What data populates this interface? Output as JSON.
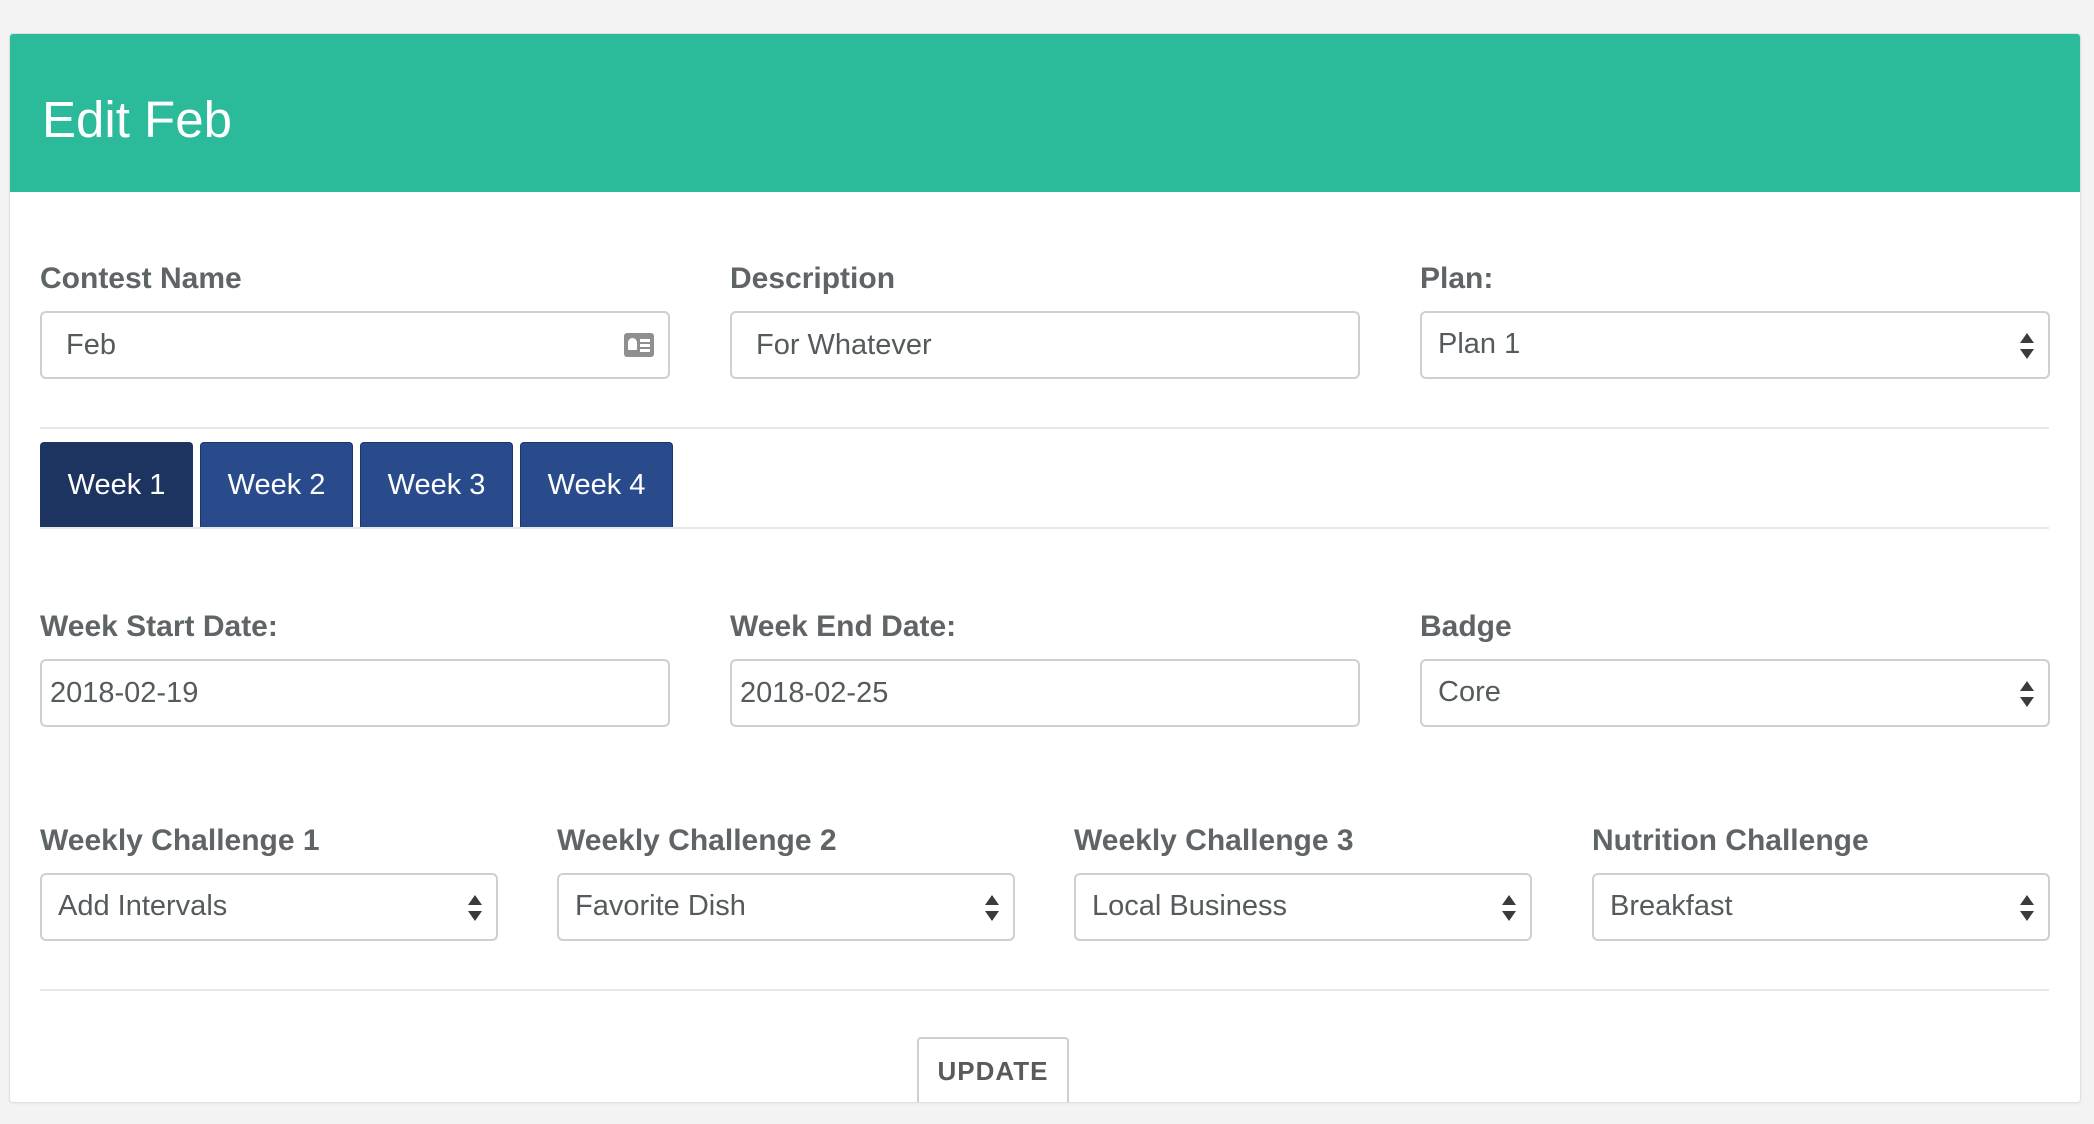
{
  "header": {
    "title": "Edit Feb",
    "background_color": "#2bbb9a"
  },
  "contest": {
    "name_label": "Contest Name",
    "name_value": "Feb",
    "name_icon": "id-card-icon",
    "description_label": "Description",
    "description_value": "For Whatever",
    "plan_label": "Plan:",
    "plan_value": "Plan 1"
  },
  "tabs": {
    "active_index": 0,
    "active_color": "#1e3460",
    "inactive_color": "#294b8c",
    "items": [
      {
        "label": "Week 1"
      },
      {
        "label": "Week 2"
      },
      {
        "label": "Week 3"
      },
      {
        "label": "Week 4"
      }
    ]
  },
  "week": {
    "start_label": "Week Start Date:",
    "start_value": "2018-02-19",
    "end_label": "Week End Date:",
    "end_value": "2018-02-25",
    "badge_label": "Badge",
    "badge_value": "Core"
  },
  "challenges": {
    "wc1_label": "Weekly Challenge 1",
    "wc1_value": "Add Intervals",
    "wc2_label": "Weekly Challenge 2",
    "wc2_value": "Favorite Dish",
    "wc3_label": "Weekly Challenge 3",
    "wc3_value": "Local Business",
    "nutrition_label": "Nutrition Challenge",
    "nutrition_value": "Breakfast"
  },
  "actions": {
    "update_label": "UPDATE"
  }
}
